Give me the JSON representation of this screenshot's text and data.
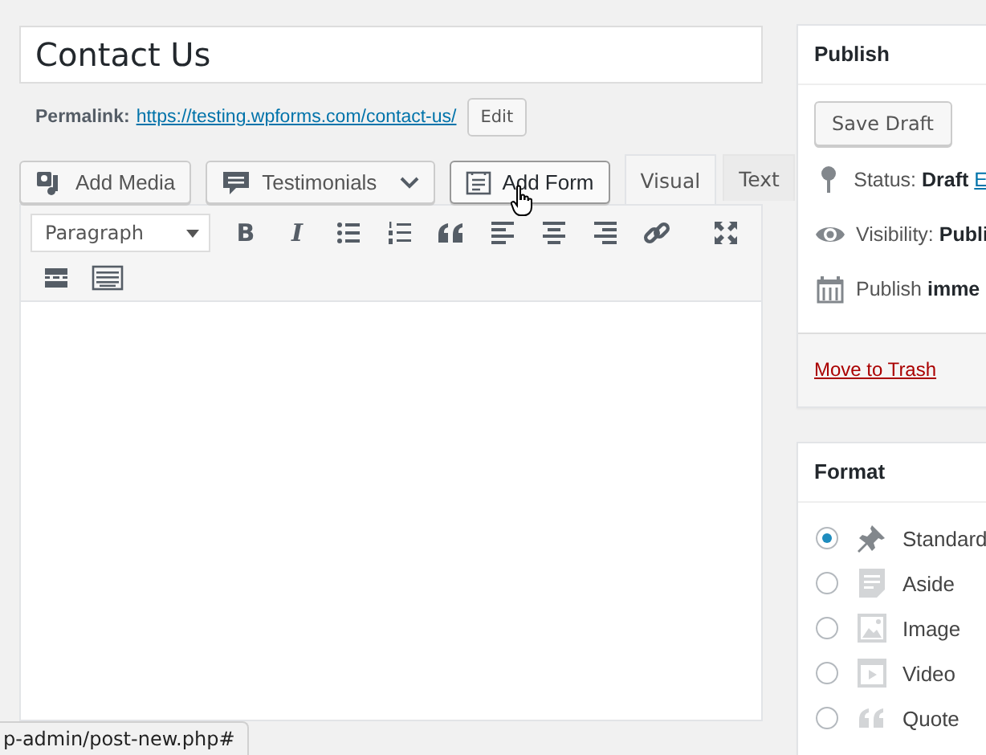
{
  "title_field": {
    "value": "Contact Us"
  },
  "permalink": {
    "label": "Permalink:",
    "url": "https://testing.wpforms.com/contact-us/",
    "edit_button": "Edit"
  },
  "media_buttons": [
    {
      "kind": "media",
      "label": "Add Media"
    },
    {
      "kind": "dropdown",
      "label": "Testimonials"
    },
    {
      "kind": "form",
      "label": "Add Form",
      "hovered": true
    }
  ],
  "editor_tabs": [
    {
      "label": "Visual",
      "selected": true
    },
    {
      "label": "Text",
      "selected": false
    }
  ],
  "toolbar": {
    "format_select": "Paragraph",
    "buttons": [
      {
        "kind": "bold",
        "label": "B"
      },
      {
        "kind": "italic",
        "label": "I"
      },
      {
        "kind": "bullets"
      },
      {
        "kind": "numbers"
      },
      {
        "kind": "quote"
      },
      {
        "kind": "align-left"
      },
      {
        "kind": "align-center"
      },
      {
        "kind": "align-right"
      },
      {
        "kind": "link"
      },
      {
        "kind": "fullscreen"
      },
      {
        "kind": "more"
      },
      {
        "kind": "keyboard"
      }
    ]
  },
  "publish": {
    "title": "Publish",
    "save_button": "Save Draft",
    "rows": [
      {
        "kind": "status",
        "label": "Status:",
        "value": "Draft",
        "link": "E"
      },
      {
        "kind": "visibility",
        "label": "Visibility:",
        "value": "Publi"
      },
      {
        "kind": "schedule",
        "label": "Publish",
        "value": "imme"
      }
    ],
    "trash_link": "Move to Trash"
  },
  "format": {
    "title": "Format",
    "options": [
      {
        "kind": "standard",
        "label": "Standard",
        "selected": true
      },
      {
        "kind": "aside",
        "label": "Aside",
        "selected": false
      },
      {
        "kind": "image",
        "label": "Image",
        "selected": false
      },
      {
        "kind": "video",
        "label": "Video",
        "selected": false
      },
      {
        "kind": "quote",
        "label": "Quote",
        "selected": false
      }
    ]
  },
  "status_bar": {
    "url": "p-admin/post-new.php#"
  }
}
